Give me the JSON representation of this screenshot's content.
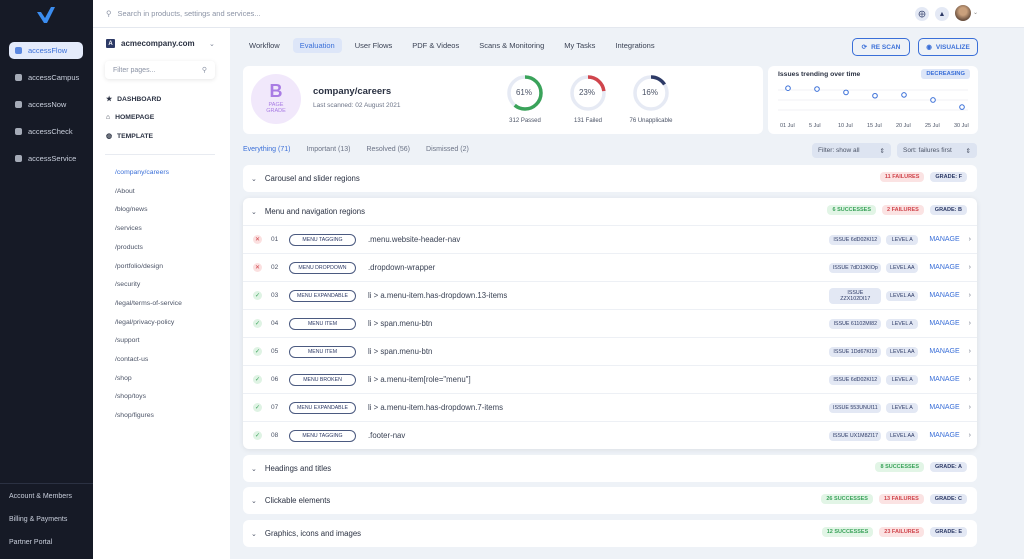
{
  "products": [
    {
      "label": "accessFlow",
      "active": true
    },
    {
      "label": "accessCampus"
    },
    {
      "label": "accessNow"
    },
    {
      "label": "accessCheck"
    },
    {
      "label": "accessService"
    }
  ],
  "sidebar_footer": [
    "Account & Members",
    "Billing & Payments",
    "Partner Portal"
  ],
  "search": {
    "placeholder": "Search in products, settings and services..."
  },
  "site": {
    "letter": "A",
    "name": "acmecompany.com"
  },
  "filter_pages": {
    "placeholder": "Filter pages..."
  },
  "nav": [
    {
      "label": "DASHBOARD",
      "icon": "star"
    },
    {
      "label": "HOMEPAGE",
      "icon": "home"
    },
    {
      "label": "TEMPLATE",
      "icon": "globe"
    }
  ],
  "pages": [
    "/company/careers",
    "/About",
    "/blog/news",
    "/services",
    "/products",
    "/portfolio/design",
    "/security",
    "/legal/terms-of-service",
    "/legal/privacy-policy",
    "/support",
    "/contact-us",
    "/shop",
    "/shop/toys",
    "/shop/figures"
  ],
  "tabs": [
    {
      "label": "Workflow"
    },
    {
      "label": "Evaluation",
      "active": true
    },
    {
      "label": "User Flows"
    },
    {
      "label": "PDF & Videos"
    },
    {
      "label": "Scans & Monitoring"
    },
    {
      "label": "My Tasks"
    },
    {
      "label": "Integrations"
    }
  ],
  "actions": {
    "rescan": "RE SCAN",
    "visualize": "VISUALIZE"
  },
  "summary": {
    "grade": "B",
    "grade_label": "PAGE GRADE",
    "page": "company/careers",
    "last_scanned": "Last scanned: 02 August 2021",
    "donuts": [
      {
        "pct": "61%",
        "value": 61,
        "label": "312 Passed",
        "color": "#3aa35a"
      },
      {
        "pct": "23%",
        "value": 23,
        "label": "131 Failed",
        "color": "#d0454c"
      },
      {
        "pct": "16%",
        "value": 16,
        "label": "76 Unapplicable",
        "color": "#2d3a66"
      }
    ]
  },
  "chart_data": {
    "type": "line",
    "title": "Issues trending over time",
    "badge": "DECREASING",
    "categories": [
      "01 Jul",
      "5 Jul",
      "10 Jul",
      "15 Jul",
      "20 Jul",
      "25 Jul",
      "30 Jul"
    ],
    "values": [
      90,
      88,
      80,
      72,
      74,
      62,
      45
    ],
    "ylim": [
      0,
      100
    ],
    "color": "#3a6fd8"
  },
  "filter_tabs": [
    {
      "label": "Everything (71)",
      "active": true
    },
    {
      "label": "Important (13)"
    },
    {
      "label": "Resolved (56)"
    },
    {
      "label": "Dismissed (2)"
    }
  ],
  "filter_select": "Filter: show all",
  "sort_select": "Sort: failures first",
  "groups": [
    {
      "title": "Carousel and slider regions",
      "failures": "11 FAILURES",
      "grade": "GRADE: F"
    },
    {
      "title": "Menu and navigation regions",
      "successes": "6 SUCCESSES",
      "failures": "2 FAILURES",
      "grade": "GRADE: B",
      "expanded": true,
      "rows": [
        {
          "status": "fail",
          "num": "01",
          "tag": "MENU TAGGING",
          "selector": ".menu.website-header-nav",
          "issue": "ISSUE 6dD02KI12",
          "level": "LEVEL A"
        },
        {
          "status": "fail",
          "num": "02",
          "tag": "MENU DROPDOWN",
          "selector": ".dropdown-wrapper",
          "issue": "ISSUE 7dD13KIOp",
          "level": "LEVEL AA"
        },
        {
          "status": "pass",
          "num": "03",
          "tag": "MENU EXPANDABLE",
          "selector": "li > a.menu-item.has-dropdown.13-items",
          "issue": "ISSUE ZZX102DI17",
          "level": "LEVEL AA"
        },
        {
          "status": "pass",
          "num": "04",
          "tag": "MENU ITEM",
          "selector": "li > span.menu-btn",
          "issue": "ISSUE 61102MI82",
          "level": "LEVEL A"
        },
        {
          "status": "pass",
          "num": "05",
          "tag": "MENU ITEM",
          "selector": "li > span.menu-btn",
          "issue": "ISSUE 1Dd67KI19",
          "level": "LEVEL AA"
        },
        {
          "status": "pass",
          "num": "06",
          "tag": "MENU BROKEN",
          "selector": "li > a.menu-item[role=\"menu\"]",
          "issue": "ISSUE 6dD02KI12",
          "level": "LEVEL A"
        },
        {
          "status": "pass",
          "num": "07",
          "tag": "MENU EXPANDABLE",
          "selector": "li > a.menu-item.has-dropdown.7-items",
          "issue": "ISSUE 553UNUI11",
          "level": "LEVEL A"
        },
        {
          "status": "pass",
          "num": "08",
          "tag": "MENU TAGGING",
          "selector": ".footer-nav",
          "issue": "ISSUE UX1M8ZI17",
          "level": "LEVEL AA"
        }
      ]
    },
    {
      "title": "Headings and titles",
      "successes": "8 SUCCESSES",
      "grade": "GRADE: A"
    },
    {
      "title": "Clickable elements",
      "successes": "26 SUCCESSES",
      "failures": "13 FAILURES",
      "grade": "GRADE: C"
    },
    {
      "title": "Graphics, icons and images",
      "successes": "12 SUCCESSES",
      "failures": "23 FAILURES",
      "grade": "GRADE: E"
    }
  ],
  "manage_label": "MANAGE"
}
